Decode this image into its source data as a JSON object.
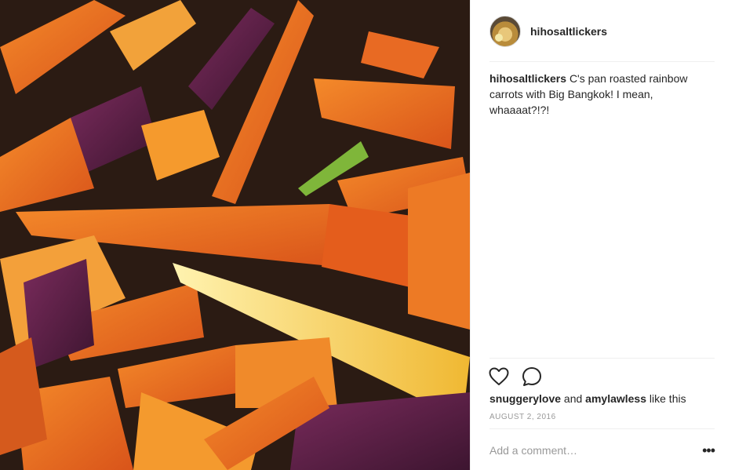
{
  "post": {
    "username": "hihosaltlickers",
    "caption": {
      "username": "hihosaltlickers",
      "text": "C's pan roasted rainbow carrots with Big Bangkok! I mean, whaaaat?!?!"
    },
    "likes": {
      "user1": "snuggerylove",
      "connector": "and",
      "user2": "amylawless",
      "suffix": "like this"
    },
    "date": "AUGUST 2, 2016",
    "comment": {
      "placeholder": "Add a comment…",
      "value": ""
    },
    "more_label": "•••"
  },
  "photo": {
    "subject": "pan roasted rainbow carrots",
    "colors": {
      "orange": "#e8691e",
      "purple": "#5a1f45",
      "yellow": "#f2c24a",
      "green": "#7fb63a"
    }
  },
  "icons": {
    "like": "heart-icon",
    "comment": "comment-bubble-icon",
    "more": "more-options-icon"
  }
}
